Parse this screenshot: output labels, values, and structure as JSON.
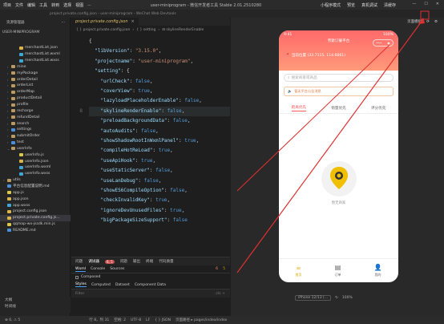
{
  "titlebar": {
    "menu": [
      "项目",
      "文件",
      "编辑",
      "工具",
      "转到",
      "选择",
      "视图",
      "..."
    ],
    "title": "user-miniprogram - 微信开发者工具 Stable 2.01.2510280",
    "tools": [
      "小程序模式",
      "预览",
      "真机调试",
      "清缓存"
    ]
  },
  "pathbar": {
    "text": "project.private.config.json - user-miniprogram - WeChat Web Devtools"
  },
  "sidebar": {
    "header": "资源管理器",
    "root": "USER-MINIPROGRAM",
    "items": [
      {
        "label": "merchantList.json",
        "indent": 3,
        "color": "#d8b44a",
        "arrow": ""
      },
      {
        "label": "merchantList.wxml",
        "indent": 3,
        "color": "#3fa7d6",
        "arrow": ""
      },
      {
        "label": "merchantList.wxss",
        "indent": 3,
        "color": "#3fa7d6",
        "arrow": ""
      },
      {
        "label": "mine",
        "indent": 1,
        "color": "#b89a62",
        "arrow": "›"
      },
      {
        "label": "myPackage",
        "indent": 1,
        "color": "#b89a62",
        "arrow": "›"
      },
      {
        "label": "orderDetail",
        "indent": 1,
        "color": "#b89a62",
        "arrow": "›"
      },
      {
        "label": "orderList",
        "indent": 1,
        "color": "#b89a62",
        "arrow": "›"
      },
      {
        "label": "orderMap",
        "indent": 1,
        "color": "#b89a62",
        "arrow": "›"
      },
      {
        "label": "productDetail",
        "indent": 1,
        "color": "#b89a62",
        "arrow": "›"
      },
      {
        "label": "profile",
        "indent": 1,
        "color": "#b89a62",
        "arrow": "›"
      },
      {
        "label": "recharge",
        "indent": 1,
        "color": "#b89a62",
        "arrow": "›"
      },
      {
        "label": "refundDetail",
        "indent": 1,
        "color": "#b89a62",
        "arrow": "›"
      },
      {
        "label": "search",
        "indent": 1,
        "color": "#b89a62",
        "arrow": "›"
      },
      {
        "label": "settings",
        "indent": 1,
        "color": "#4a90d9",
        "arrow": "›"
      },
      {
        "label": "submitOrder",
        "indent": 1,
        "color": "#b89a62",
        "arrow": "›"
      },
      {
        "label": "test",
        "indent": 1,
        "color": "#4a90d9",
        "arrow": "›"
      },
      {
        "label": "userInfo",
        "indent": 1,
        "color": "#b89a62",
        "arrow": "⌄"
      },
      {
        "label": "userInfo.js",
        "indent": 3,
        "color": "#d8c84a",
        "arrow": ""
      },
      {
        "label": "userInfo.json",
        "indent": 3,
        "color": "#d8b44a",
        "arrow": ""
      },
      {
        "label": "userInfo.wxml",
        "indent": 3,
        "color": "#3fa7d6",
        "arrow": ""
      },
      {
        "label": "userInfo.wxss",
        "indent": 3,
        "color": "#3fa7d6",
        "arrow": ""
      },
      {
        "label": "utils",
        "indent": 0,
        "color": "#b89a62",
        "arrow": "›"
      },
      {
        "label": "平台信息配置说明.md",
        "indent": 0,
        "color": "#4a90d9",
        "arrow": ""
      },
      {
        "label": "app.js",
        "indent": 0,
        "color": "#d8c84a",
        "arrow": ""
      },
      {
        "label": "app.json",
        "indent": 0,
        "color": "#d8b44a",
        "arrow": ""
      },
      {
        "label": "app.wxss",
        "indent": 0,
        "color": "#3fa7d6",
        "arrow": ""
      },
      {
        "label": "project.config.json",
        "indent": 0,
        "color": "#d8b44a",
        "arrow": ""
      },
      {
        "label": "project.private.config.js...",
        "indent": 0,
        "color": "#d8b44a",
        "arrow": "",
        "selected": true
      },
      {
        "label": "qqmap-wx-jssdk.min.js",
        "indent": 0,
        "color": "#d8c84a",
        "arrow": ""
      },
      {
        "label": "README.md",
        "indent": 0,
        "color": "#4a90d9",
        "arrow": ""
      }
    ],
    "bottom": [
      "大纲",
      "时间线"
    ]
  },
  "editor": {
    "tab": "project.private.config.json",
    "breadcrumb": [
      "{ } project.private.config.json",
      "›",
      "{ } setting",
      "›",
      "⊟ skylineRenderEnable"
    ],
    "lines": [
      {
        "n": "",
        "t": [
          [
            "p",
            "{"
          ]
        ]
      },
      {
        "n": "",
        "t": [
          [
            "k",
            "  \"libVersion\""
          ],
          [
            "p",
            ": "
          ],
          [
            "s",
            "\"3.15.0\""
          ],
          [
            "p",
            ","
          ]
        ]
      },
      {
        "n": "",
        "t": [
          [
            "k",
            "  \"projectname\""
          ],
          [
            "p",
            ": "
          ],
          [
            "s",
            "\"user-miniprogram\""
          ],
          [
            "p",
            ","
          ]
        ]
      },
      {
        "n": "",
        "t": [
          [
            "k",
            "  \"setting\""
          ],
          [
            "p",
            ": {"
          ]
        ]
      },
      {
        "n": "",
        "t": [
          [
            "k",
            "    \"urlCheck\""
          ],
          [
            "p",
            ": "
          ],
          [
            "b",
            "false"
          ],
          [
            "p",
            ","
          ]
        ]
      },
      {
        "n": "",
        "t": [
          [
            "k",
            "    \"coverView\""
          ],
          [
            "p",
            ": "
          ],
          [
            "b",
            "true"
          ],
          [
            "p",
            ","
          ]
        ]
      },
      {
        "n": "",
        "t": [
          [
            "k",
            "    \"lazyloadPlaceholderEnable\""
          ],
          [
            "p",
            ": "
          ],
          [
            "b",
            "false"
          ],
          [
            "p",
            ","
          ]
        ]
      },
      {
        "n": "8",
        "t": [
          [
            "k",
            "    \"skylineRenderEnable\""
          ],
          [
            "p",
            ": "
          ],
          [
            "b",
            "false"
          ],
          [
            "p",
            ","
          ]
        ],
        "hl": true
      },
      {
        "n": "",
        "t": [
          [
            "k",
            "    \"preloadBackgroundData\""
          ],
          [
            "p",
            ": "
          ],
          [
            "b",
            "false"
          ],
          [
            "p",
            ","
          ]
        ]
      },
      {
        "n": "",
        "t": [
          [
            "k",
            "    \"autoAudits\""
          ],
          [
            "p",
            ": "
          ],
          [
            "b",
            "false"
          ],
          [
            "p",
            ","
          ]
        ]
      },
      {
        "n": "",
        "t": [
          [
            "k",
            "    \"showShadowRootInWxmlPanel\""
          ],
          [
            "p",
            ": "
          ],
          [
            "b",
            "true"
          ],
          [
            "p",
            ","
          ]
        ]
      },
      {
        "n": "",
        "t": [
          [
            "k",
            "    \"compileHotReLoad\""
          ],
          [
            "p",
            ": "
          ],
          [
            "b",
            "true"
          ],
          [
            "p",
            ","
          ]
        ]
      },
      {
        "n": "",
        "t": [
          [
            "k",
            "    \"useApiHook\""
          ],
          [
            "p",
            ": "
          ],
          [
            "b",
            "true"
          ],
          [
            "p",
            ","
          ]
        ]
      },
      {
        "n": "",
        "t": [
          [
            "k",
            "    \"useStaticServer\""
          ],
          [
            "p",
            ": "
          ],
          [
            "b",
            "false"
          ],
          [
            "p",
            ","
          ]
        ]
      },
      {
        "n": "",
        "t": [
          [
            "k",
            "    \"useLanDebug\""
          ],
          [
            "p",
            ": "
          ],
          [
            "b",
            "false"
          ],
          [
            "p",
            ","
          ]
        ]
      },
      {
        "n": "",
        "t": [
          [
            "k",
            "    \"showES6CompileOption\""
          ],
          [
            "p",
            ": "
          ],
          [
            "b",
            "false"
          ],
          [
            "p",
            ","
          ]
        ]
      },
      {
        "n": "",
        "t": [
          [
            "k",
            "    \"checkInvalidKey\""
          ],
          [
            "p",
            ": "
          ],
          [
            "b",
            "true"
          ],
          [
            "p",
            ","
          ]
        ]
      },
      {
        "n": "",
        "t": [
          [
            "k",
            "    \"ignoreDevUnusedFiles\""
          ],
          [
            "p",
            ": "
          ],
          [
            "b",
            "true"
          ],
          [
            "p",
            ","
          ]
        ]
      },
      {
        "n": "",
        "t": [
          [
            "k",
            "    \"bigPackageSizeSupport\""
          ],
          [
            "p",
            ": "
          ],
          [
            "b",
            "false"
          ]
        ]
      }
    ]
  },
  "devtools": {
    "tabs": [
      "问题",
      "调试器",
      "问题",
      "输出",
      "终端",
      "代码质量"
    ],
    "badge": "6, 5",
    "row2": [
      "Wxml",
      "Console",
      "Sources"
    ],
    "counts": {
      "errors": "6",
      "warnings": "5"
    },
    "compose_label": "Composed",
    "row4": [
      "Styles",
      "Computed",
      "Dataset",
      "Component Data"
    ],
    "filter_placeholder": "Filter",
    "cls": ".cls",
    "plus": "+"
  },
  "simulator": {
    "top_label": "页面模拟",
    "status_time": "9:41",
    "status_right": "100%",
    "nav_title": "劳斯订餐平台",
    "location": "当前位置 (33.7115, 114.6861)",
    "search_placeholder": "搜索商家或商品",
    "notice": "暂无平台公告消息",
    "tabs": [
      "距离优先",
      "销量优先",
      "评分优先"
    ],
    "empty_text": "暂无商家",
    "tabbar": [
      {
        "label": "首页",
        "icon": "home-icon",
        "active": true
      },
      {
        "label": "订单",
        "icon": "order-icon",
        "active": false
      },
      {
        "label": "我的",
        "icon": "user-icon",
        "active": false
      }
    ],
    "device": "iPhone 12/13 (...",
    "zoom": "100%"
  },
  "statusbar": {
    "items": [
      "⊗ 6, ⚠ 5",
      "行 8，列 31",
      "空格: 2",
      "UTF-8",
      "LF",
      "{ } JSON",
      "页面路径 ▸ pages/index/index"
    ]
  },
  "colors": {
    "accent": "#ff5a5a",
    "brand": "#e0a400",
    "arrow": "#e03030"
  }
}
